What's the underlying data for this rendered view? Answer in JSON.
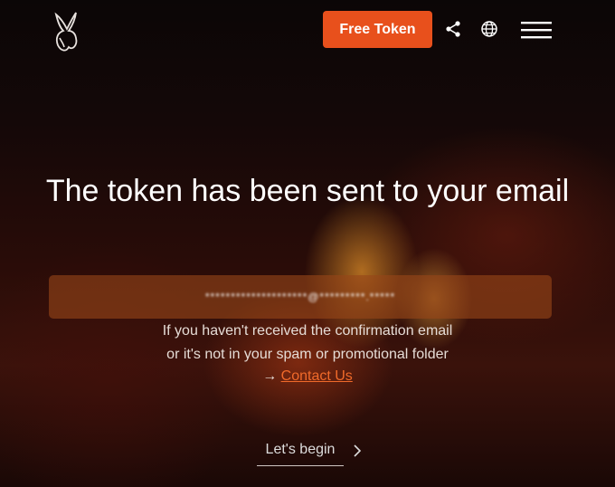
{
  "header": {
    "free_token_label": "Free Token"
  },
  "hero": {
    "title": "The token has been sent to your email",
    "email_masked": "********************@*********.*****",
    "info_line1": "If you haven't received the confirmation email",
    "info_line2": "or it's not in your spam or promotional folder",
    "contact_arrow": "→",
    "contact_label": "Contact Us",
    "begin_label": "Let's begin"
  },
  "icons": {
    "logo": "mask-logo-icon",
    "share": "share-icon",
    "globe": "globe-icon",
    "menu": "hamburger-menu-icon",
    "chevron": "chevron-right-icon"
  },
  "colors": {
    "accent": "#e8501c",
    "link": "#f06a2a",
    "email_box": "#96461a"
  }
}
